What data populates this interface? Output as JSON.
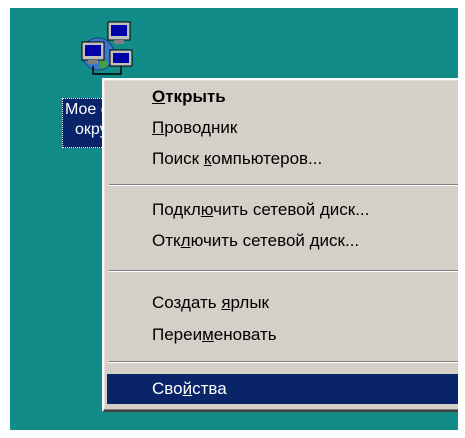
{
  "desktop": {
    "background_color": "#118C88",
    "icon": {
      "name": "network-neighborhood-icon",
      "label_line1": "Мое с",
      "label_line2": "окру"
    }
  },
  "context_menu": {
    "items": [
      {
        "pre": "",
        "ul": "О",
        "post": "ткрыть",
        "bold": true
      },
      {
        "pre": "",
        "ul": "П",
        "post": "роводник"
      },
      {
        "pre": "Поиск ",
        "ul": "к",
        "post": "омпьютеров..."
      },
      {
        "pre": "Подкл",
        "ul": "ю",
        "post": "чить сетевой диск..."
      },
      {
        "pre": "Отк",
        "ul": "л",
        "post": "ючить сетевой диск..."
      },
      {
        "pre": "Создать ",
        "ul": "я",
        "post": "рлык"
      },
      {
        "pre": "Переи",
        "ul": "м",
        "post": "еновать"
      },
      {
        "pre": "Сво",
        "ul": "й",
        "post": "ства",
        "selected": true
      }
    ]
  },
  "colors": {
    "menu_bg": "#D4D0C8",
    "highlight": "#0A246A"
  }
}
